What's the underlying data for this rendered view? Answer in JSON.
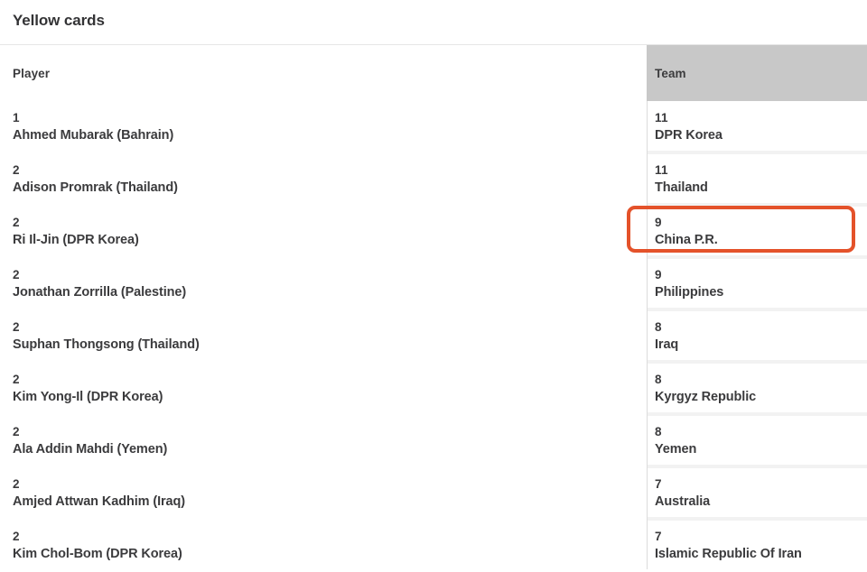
{
  "page": {
    "title": "Yellow cards"
  },
  "colors": {
    "highlight": "#e4522a",
    "header_background": "#c8c8c8",
    "text": "#3b3b3d",
    "rule": "#e6e6e6"
  },
  "table": {
    "columns": [
      {
        "key": "player",
        "header": "Player"
      },
      {
        "key": "team",
        "header": "Team"
      }
    ],
    "player_rows": [
      {
        "count": "1",
        "label": "Ahmed Mubarak (Bahrain)"
      },
      {
        "count": "2",
        "label": "Adison Promrak (Thailand)"
      },
      {
        "count": "2",
        "label": "Ri Il-Jin (DPR Korea)"
      },
      {
        "count": "2",
        "label": "Jonathan Zorrilla (Palestine)"
      },
      {
        "count": "2",
        "label": "Suphan Thongsong (Thailand)"
      },
      {
        "count": "2",
        "label": "Kim Yong-Il (DPR Korea)"
      },
      {
        "count": "2",
        "label": "Ala Addin Mahdi (Yemen)"
      },
      {
        "count": "2",
        "label": "Amjed Attwan Kadhim (Iraq)"
      },
      {
        "count": "2",
        "label": "Kim Chol-Bom (DPR Korea)"
      }
    ],
    "team_rows": [
      {
        "count": "11",
        "label": "DPR Korea",
        "highlighted": false
      },
      {
        "count": "11",
        "label": "Thailand",
        "highlighted": false
      },
      {
        "count": "9",
        "label": "China P.R.",
        "highlighted": true
      },
      {
        "count": "9",
        "label": "Philippines",
        "highlighted": false
      },
      {
        "count": "8",
        "label": "Iraq",
        "highlighted": false
      },
      {
        "count": "8",
        "label": "Kyrgyz Republic",
        "highlighted": false
      },
      {
        "count": "8",
        "label": "Yemen",
        "highlighted": false
      },
      {
        "count": "7",
        "label": "Australia",
        "highlighted": false
      },
      {
        "count": "7",
        "label": "Islamic Republic Of Iran",
        "highlighted": false
      }
    ]
  }
}
